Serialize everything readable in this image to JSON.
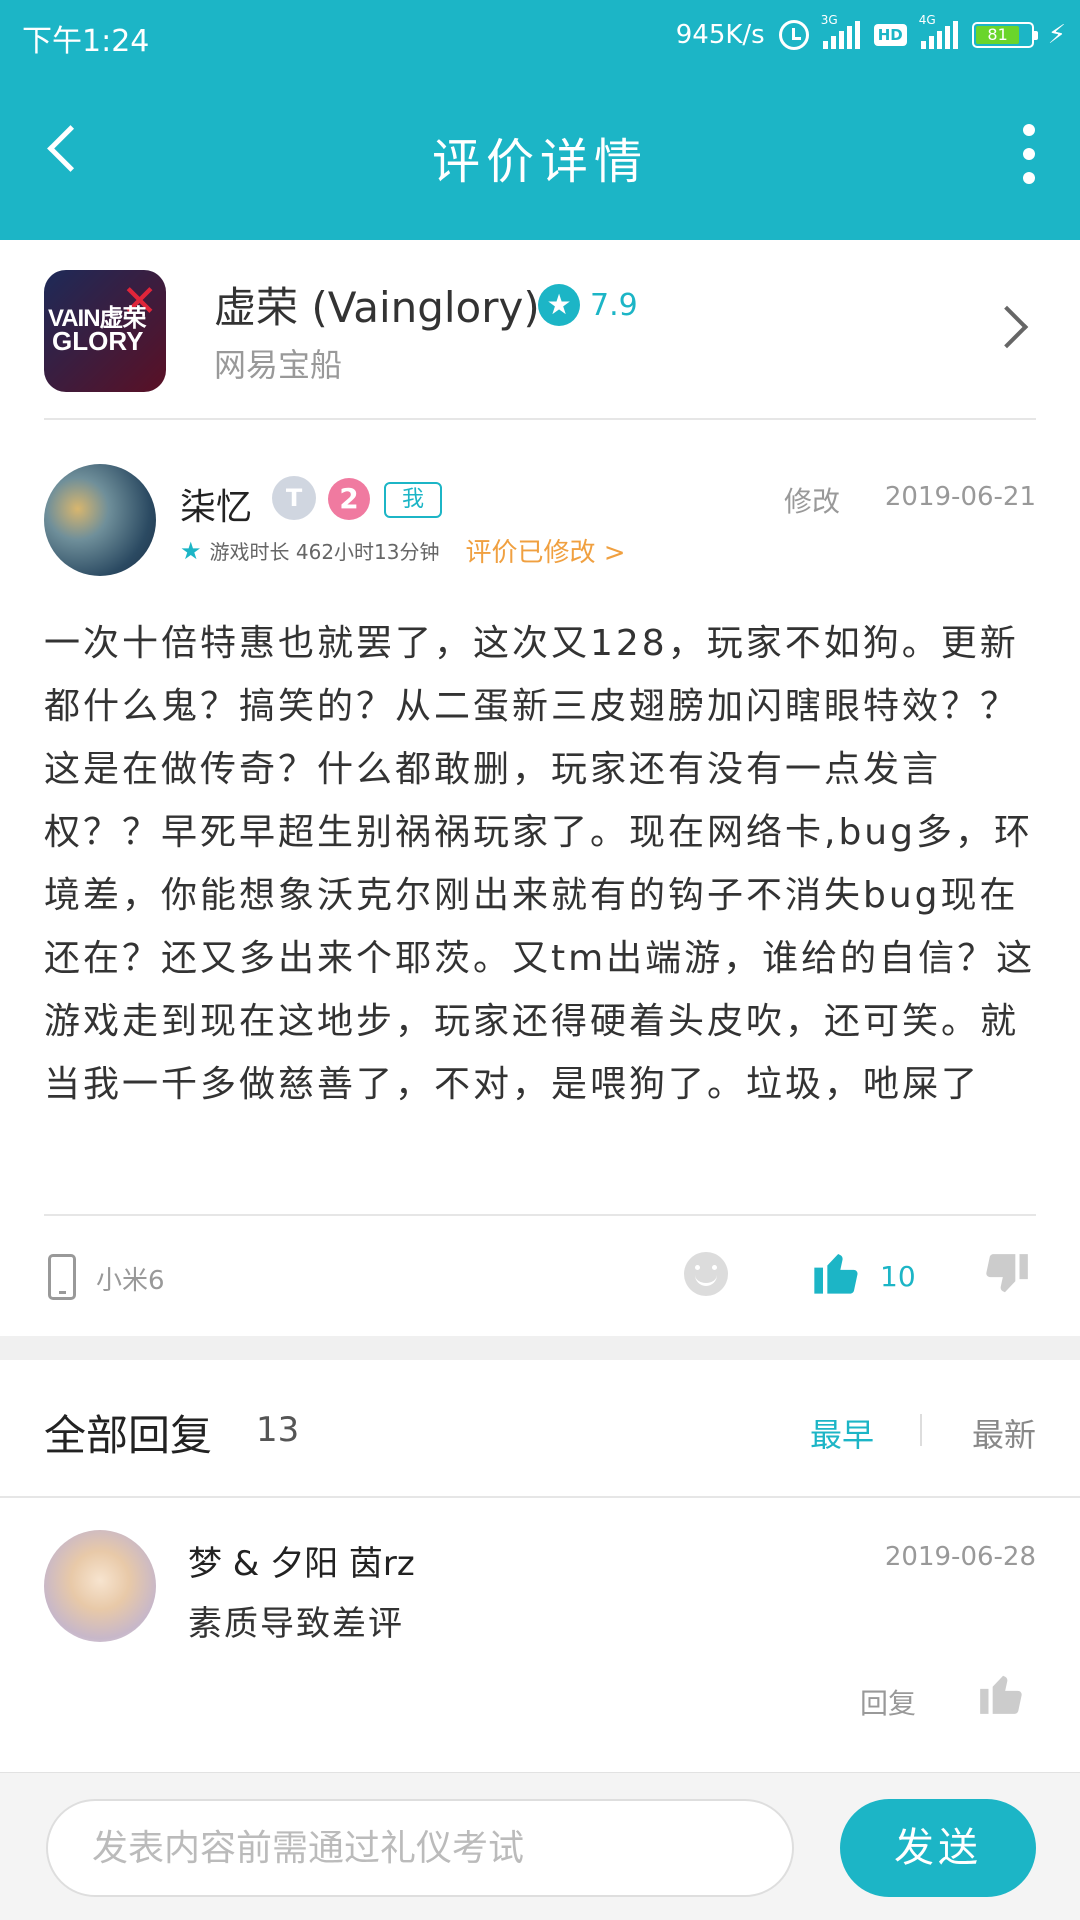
{
  "status_bar": {
    "time": "下午1:24",
    "network_speed": "945K/s",
    "sim1": "3G",
    "hd": "HD",
    "sim2": "4G",
    "battery_level": "81"
  },
  "header": {
    "title": "评价详情",
    "back_icon": "chevron-left-icon",
    "more_icon": "more-vertical-icon"
  },
  "game": {
    "icon_line1": "VAIN虚荣",
    "icon_line2": "GLORY",
    "name": "虚荣 (Vainglory)",
    "rating": "7.9",
    "publisher": "网易宝船"
  },
  "review": {
    "username": "柒忆",
    "badge_level": "T",
    "badge_number": "2",
    "badge_me": "我",
    "edit_label": "修改",
    "date": "2019-06-21",
    "play_time": "游戏时长 462小时13分钟",
    "modified_label": "评价已修改 >",
    "content": "一次十倍特惠也就罢了，这次又128，玩家不如狗。更新都什么鬼？搞笑的？从二蛋新三皮翅膀加闪瞎眼特效？？这是在做传奇？什么都敢删，玩家还有没有一点发言权？？早死早超生别祸祸玩家了。现在网络卡,bug多，环境差，你能想象沃克尔刚出来就有的钩子不消失bug现在还在？还又多出来个耶茨。又tm出端游，谁给的自信？这游戏走到现在这地步，玩家还得硬着头皮吹，还可笑。就当我一千多做慈善了，不对，是喂狗了。垃圾，吔屎了",
    "device": "小米6",
    "like_count": "10"
  },
  "replies": {
    "title": "全部回复",
    "count": "13",
    "sort_earliest": "最早",
    "sort_latest": "最新",
    "items": [
      {
        "name": "梦 & 夕阳 茵rz",
        "date": "2019-06-28",
        "text": "素质导致差评",
        "reply_label": "回复"
      }
    ]
  },
  "compose": {
    "placeholder": "发表内容前需通过礼仪考试",
    "send_label": "发送"
  },
  "colors": {
    "accent": "#1cb5c6",
    "modified": "#f0a040"
  }
}
